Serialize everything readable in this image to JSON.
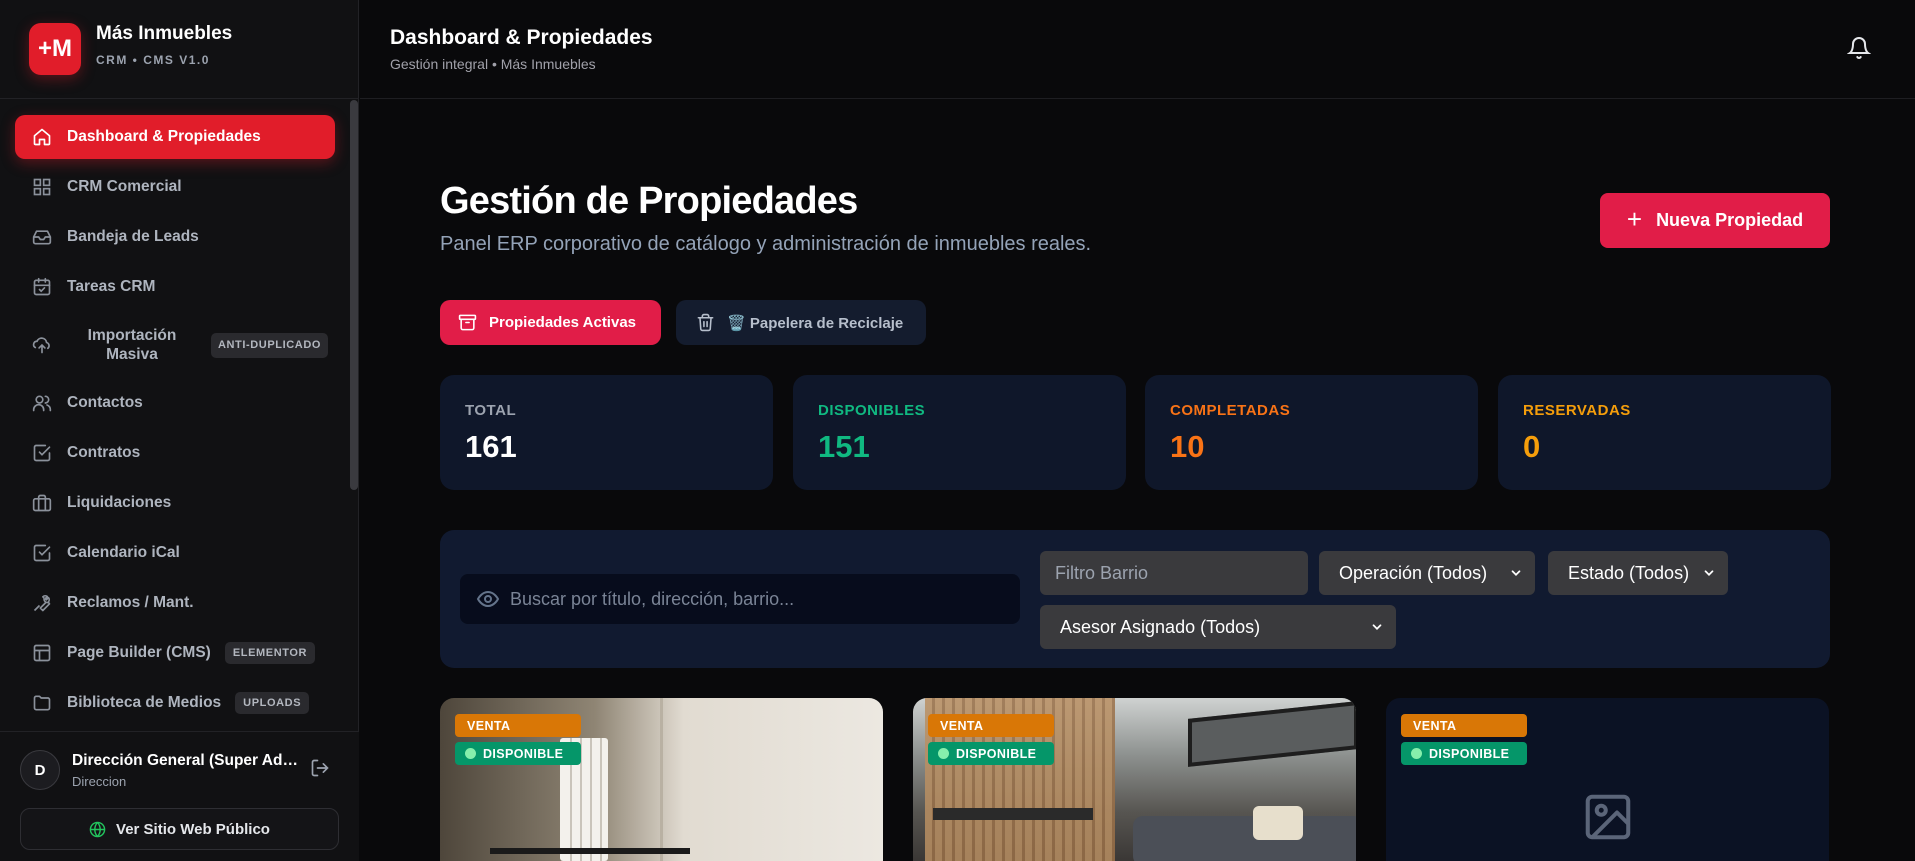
{
  "brand": {
    "logo": "+M",
    "name": "Más Inmuebles",
    "subtitle": "CRM • CMS V1.0"
  },
  "sidebar": {
    "items": [
      {
        "label": "Dashboard & Propiedades",
        "icon": "home-icon",
        "active": true
      },
      {
        "label": "CRM Comercial",
        "icon": "grid-icon"
      },
      {
        "label": "Bandeja de Leads",
        "icon": "inbox-icon"
      },
      {
        "label": "Tareas CRM",
        "icon": "calendar-check-icon"
      },
      {
        "label": "Importación Masiva",
        "icon": "cloud-upload-icon",
        "badge": "ANTI-DUPLICADO"
      },
      {
        "label": "Contactos",
        "icon": "users-icon"
      },
      {
        "label": "Contratos",
        "icon": "check-square-icon"
      },
      {
        "label": "Liquidaciones",
        "icon": "briefcase-icon"
      },
      {
        "label": "Calendario iCal",
        "icon": "check-square-icon"
      },
      {
        "label": "Reclamos / Mant.",
        "icon": "wrench-icon"
      },
      {
        "label": "Page Builder (CMS)",
        "icon": "layout-icon",
        "badge": "ELEMENTOR"
      },
      {
        "label": "Biblioteca de Medios",
        "icon": "folder-icon",
        "badge": "UPLOADS"
      }
    ],
    "user": {
      "initial": "D",
      "name": "Dirección General (Super Admin)",
      "role": "Direccion"
    },
    "site_button": "Ver Sitio Web Público"
  },
  "topbar": {
    "title": "Dashboard & Propiedades",
    "subtitle": "Gestión integral • Más Inmuebles"
  },
  "main": {
    "title": "Gestión de Propiedades",
    "subtitle": "Panel ERP corporativo de catálogo y administración de inmuebles reales.",
    "new_button": "Nueva Propiedad",
    "tabs": [
      {
        "label": "Propiedades Activas",
        "active": true
      },
      {
        "label": "🗑️ Papelera de Reciclaje",
        "active": false
      }
    ],
    "stats": [
      {
        "label": "TOTAL",
        "value": "161",
        "color": "#ffffff",
        "label_color": "#9ca3af"
      },
      {
        "label": "DISPONIBLES",
        "value": "151",
        "color": "#10b981",
        "label_color": "#10b981"
      },
      {
        "label": "COMPLETADAS",
        "value": "10",
        "color": "#f97316",
        "label_color": "#f97316"
      },
      {
        "label": "RESERVADAS",
        "value": "0",
        "color": "#f59e0b",
        "label_color": "#f59e0b"
      }
    ],
    "filters": {
      "search_placeholder": "Buscar por título, dirección, barrio...",
      "barrio_placeholder": "Filtro Barrio",
      "operacion": "Operación (Todos)",
      "estado": "Estado (Todos)",
      "asesor": "Asesor Asignado (Todos)"
    },
    "cards": [
      {
        "operation": "VENTA",
        "status": "DISPONIBLE"
      },
      {
        "operation": "VENTA",
        "status": "DISPONIBLE"
      },
      {
        "operation": "VENTA",
        "status": "DISPONIBLE"
      }
    ]
  },
  "colors": {
    "accent": "#e11d48",
    "sidebar_active": "#e11d2a",
    "available": "#059669",
    "sale": "#d97706"
  }
}
